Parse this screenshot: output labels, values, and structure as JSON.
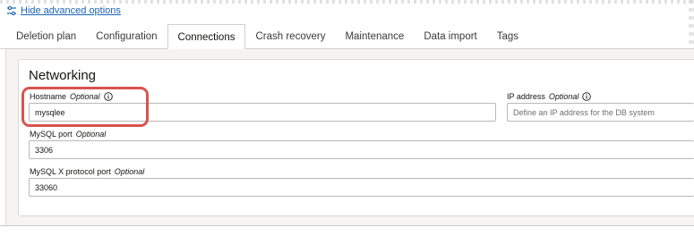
{
  "advanced_link": {
    "label": "Hide advanced options",
    "icon": "sliders-icon"
  },
  "tabs": [
    {
      "label": "Deletion plan",
      "active": false
    },
    {
      "label": "Configuration",
      "active": false
    },
    {
      "label": "Connections",
      "active": true
    },
    {
      "label": "Crash recovery",
      "active": false
    },
    {
      "label": "Maintenance",
      "active": false
    },
    {
      "label": "Data import",
      "active": false
    },
    {
      "label": "Tags",
      "active": false
    }
  ],
  "networking": {
    "title": "Networking",
    "hostname": {
      "label": "Hostname",
      "optional": "Optional",
      "value": "mysqlee"
    },
    "ip_address": {
      "label": "IP address",
      "optional": "Optional",
      "value": "",
      "placeholder": "Define an IP address for the DB system"
    },
    "mysql_port": {
      "label": "MySQL port",
      "optional": "Optional",
      "value": "3306"
    },
    "mysqlx_port": {
      "label": "MySQL X protocol port",
      "optional": "Optional",
      "value": "33060"
    }
  },
  "colors": {
    "accent_link": "#1b63b8",
    "highlight": "#d9534f"
  }
}
